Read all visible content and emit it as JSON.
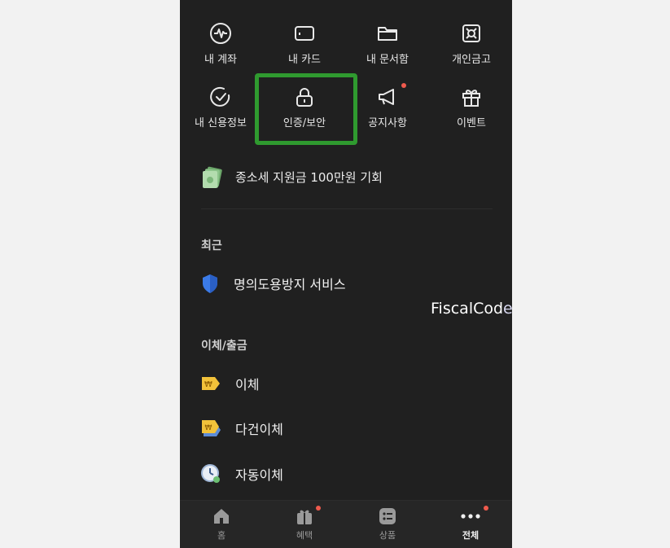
{
  "menu_grid": {
    "row1": [
      {
        "label": "내 계좌",
        "icon": "pulse-circle-icon"
      },
      {
        "label": "내 카드",
        "icon": "card-icon"
      },
      {
        "label": "내 문서함",
        "icon": "folder-icon"
      },
      {
        "label": "개인금고",
        "icon": "safe-icon"
      }
    ],
    "row2": [
      {
        "label": "내 신용정보",
        "icon": "check-circle-icon"
      },
      {
        "label": "인증/보안",
        "icon": "lock-icon"
      },
      {
        "label": "공지사항",
        "icon": "megaphone-icon",
        "badge": true
      },
      {
        "label": "이벤트",
        "icon": "gift-icon"
      }
    ]
  },
  "promo": {
    "text": "종소세 지원금 100만원 기회",
    "icon": "money-stack-icon"
  },
  "recent": {
    "title": "최근",
    "items": [
      {
        "label": "명의도용방지 서비스",
        "icon": "shield-icon"
      }
    ]
  },
  "transfer": {
    "title": "이체/출금",
    "items": [
      {
        "label": "이체",
        "icon": "won-tag-icon"
      },
      {
        "label": "다건이체",
        "icon": "won-tags-icon"
      },
      {
        "label": "자동이체",
        "icon": "clock-icon"
      }
    ]
  },
  "bottom_nav": [
    {
      "label": "홈",
      "icon": "home-icon",
      "active": false
    },
    {
      "label": "혜택",
      "icon": "gift-box-icon",
      "active": false,
      "badge": true
    },
    {
      "label": "상품",
      "icon": "list-box-icon",
      "active": false
    },
    {
      "label": "전체",
      "icon": "more-dots-icon",
      "active": true,
      "badge": true
    }
  ],
  "watermark": {
    "text_main": "FiscalCod",
    "text_fade": "e"
  },
  "colors": {
    "background": "#202020",
    "highlight": "#2f9a2f",
    "badge": "#ef5a4d",
    "shield": "#3b7be8",
    "won_tag": "#f2c23a"
  }
}
